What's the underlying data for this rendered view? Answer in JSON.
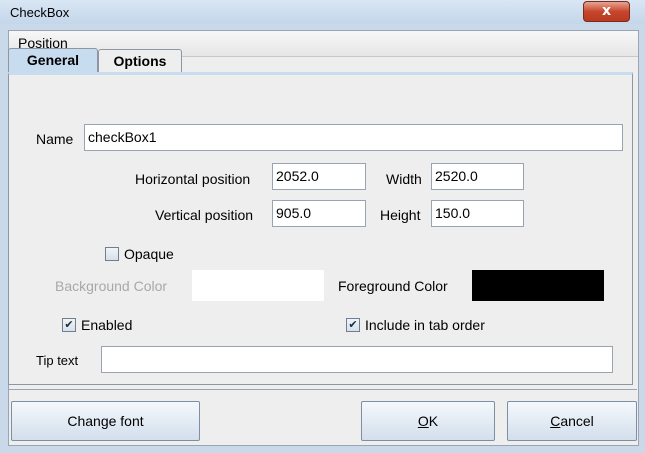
{
  "window": {
    "title": "CheckBox",
    "close_glyph": "x"
  },
  "menu": {
    "position": "Position"
  },
  "tabs": [
    {
      "label": "General",
      "selected": true
    },
    {
      "label": "Options",
      "selected": false
    }
  ],
  "form": {
    "name_label": "Name",
    "name_value": "checkBox1",
    "hpos_label": "Horizontal position",
    "hpos_value": "2052.0",
    "width_label": "Width",
    "width_value": "2520.0",
    "vpos_label": "Vertical position",
    "vpos_value": "905.0",
    "height_label": "Height",
    "height_value": "150.0",
    "opaque_label": "Opaque",
    "opaque_checked": false,
    "bg_color_label": "Background Color",
    "bg_color": "#ffffff",
    "fg_color_label": "Foreground Color",
    "fg_color": "#000000",
    "enabled_label": "Enabled",
    "enabled_checked": true,
    "tab_order_label": "Include in tab order",
    "tab_order_checked": true,
    "tip_label": "Tip text",
    "tip_value": ""
  },
  "buttons": {
    "change_font": "Change font",
    "ok_mnemonic": "O",
    "ok_rest": "K",
    "cancel_mnemonic": "C",
    "cancel_rest": "ancel"
  },
  "check_glyph": "✔",
  "colors": {
    "tab_selected": "#c8dcf0",
    "window_frame": "#c9d9ea",
    "close_button": "#c7462c"
  }
}
